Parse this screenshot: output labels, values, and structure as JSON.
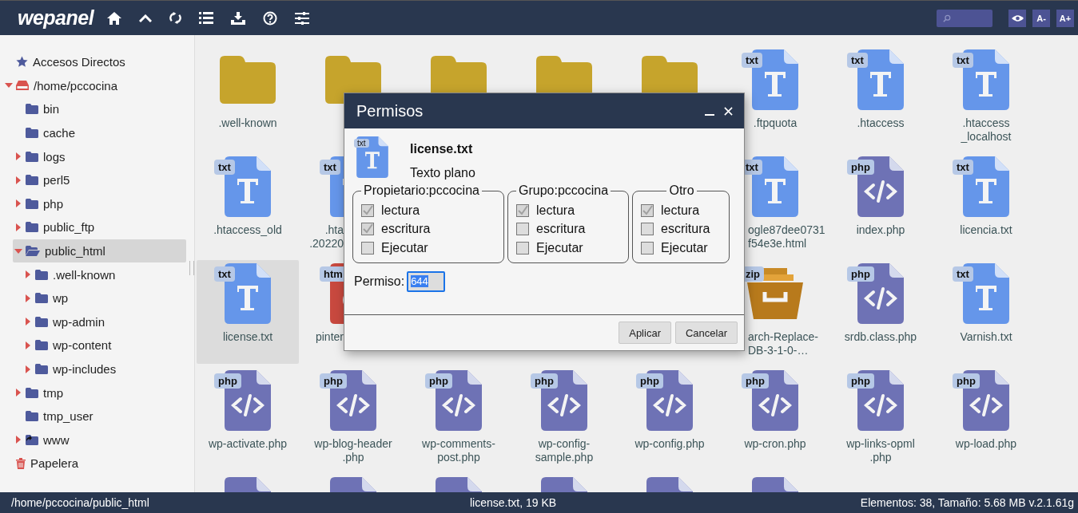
{
  "app": {
    "logo": "wepanel",
    "font_buttons": [
      "A-",
      "A+"
    ]
  },
  "sidebar": {
    "items": [
      {
        "label": "Accesos Directos",
        "kind": "star",
        "selected": false
      },
      {
        "label": "/home/pccocina",
        "kind": "drive",
        "expandable": true,
        "expanded": true,
        "selected": false,
        "children": [
          {
            "label": "bin",
            "kind": "folder",
            "selected": false
          },
          {
            "label": "cache",
            "kind": "folder",
            "selected": false
          },
          {
            "label": "logs",
            "kind": "folder",
            "expandable": true,
            "expanded": false,
            "selected": false
          },
          {
            "label": "perl5",
            "kind": "folder",
            "expandable": true,
            "expanded": false,
            "selected": false
          },
          {
            "label": "php",
            "kind": "folder",
            "expandable": true,
            "expanded": false,
            "selected": false
          },
          {
            "label": "public_ftp",
            "kind": "folder",
            "expandable": true,
            "expanded": false,
            "selected": false
          },
          {
            "label": "public_html",
            "kind": "open-folder",
            "expandable": true,
            "expanded": true,
            "selected": true,
            "children": [
              {
                "label": ".well-known",
                "kind": "folder",
                "expandable": true,
                "expanded": false,
                "selected": false
              },
              {
                "label": "wp",
                "kind": "folder",
                "expandable": true,
                "expanded": false,
                "selected": false
              },
              {
                "label": "wp-admin",
                "kind": "folder",
                "expandable": true,
                "expanded": false,
                "selected": false
              },
              {
                "label": "wp-content",
                "kind": "folder",
                "expandable": true,
                "expanded": false,
                "selected": false
              },
              {
                "label": "wp-includes",
                "kind": "folder",
                "expandable": true,
                "expanded": false,
                "selected": false
              }
            ]
          },
          {
            "label": "tmp",
            "kind": "folder",
            "expandable": true,
            "expanded": false,
            "selected": false
          },
          {
            "label": "tmp_user",
            "kind": "folder",
            "selected": false
          },
          {
            "label": "www",
            "kind": "link-folder",
            "expandable": true,
            "expanded": false,
            "selected": false
          }
        ]
      },
      {
        "label": "Papelera",
        "kind": "trash",
        "selected": false
      }
    ]
  },
  "files": [
    {
      "kind": "folder",
      "label": [
        ".well-known"
      ],
      "selected": false
    },
    {
      "kind": "folder",
      "selected": false
    },
    {
      "kind": "folder",
      "selected": false
    },
    {
      "kind": "folder",
      "selected": false
    },
    {
      "kind": "folder",
      "selected": false
    },
    {
      "kind": "txt",
      "badge": "txt",
      "label": [
        ".ftpquota"
      ],
      "selected": false
    },
    {
      "kind": "txt",
      "badge": "txt",
      "label": [
        ".htaccess"
      ],
      "selected": false
    },
    {
      "kind": "txt",
      "badge": "txt",
      "label": [
        ".htaccess",
        "_localhost"
      ],
      "selected": false
    },
    {
      "kind": "txt",
      "badge": "txt",
      "label": [
        ".htaccess_old"
      ],
      "selected": false
    },
    {
      "kind": "txt",
      "badge": "txt",
      "label": [
        ".hta",
        ".20220"
      ],
      "clipped_right": true,
      "selected": false
    },
    {
      "kind": "covered"
    },
    {
      "kind": "covered"
    },
    {
      "kind": "covered"
    },
    {
      "kind": "txt",
      "badge": "txt",
      "label": [
        "ogle87dee0731",
        "f54e3e.html"
      ],
      "clipped_left": true,
      "selected": false
    },
    {
      "kind": "php",
      "badge": "php",
      "label": [
        "index.php"
      ],
      "selected": false
    },
    {
      "kind": "txt",
      "badge": "txt",
      "label": [
        "licencia.txt"
      ],
      "selected": false
    },
    {
      "kind": "txt",
      "badge": "txt",
      "label": [
        "license.txt"
      ],
      "selected": true
    },
    {
      "kind": "htm",
      "badge": "htm",
      "label": [
        "pinter"
      ],
      "clipped_right": true,
      "selected": false
    },
    {
      "kind": "covered"
    },
    {
      "kind": "covered"
    },
    {
      "kind": "covered"
    },
    {
      "kind": "zip",
      "badge": "zip",
      "label": [
        "arch-Replace-",
        "DB-3-1-0-…"
      ],
      "clipped_left": true,
      "selected": false
    },
    {
      "kind": "php",
      "badge": "php",
      "label": [
        "srdb.class.php"
      ],
      "selected": false
    },
    {
      "kind": "txt",
      "badge": "txt",
      "label": [
        "Varnish.txt"
      ],
      "selected": false
    },
    {
      "kind": "php",
      "badge": "php",
      "label": [
        "wp-activate.php"
      ],
      "selected": false
    },
    {
      "kind": "php",
      "badge": "php",
      "label": [
        "wp-blog-header",
        ".php"
      ],
      "selected": false
    },
    {
      "kind": "php",
      "badge": "php",
      "label": [
        "wp-comments-",
        "post.php"
      ],
      "selected": false
    },
    {
      "kind": "php",
      "badge": "php",
      "label": [
        "wp-config-",
        "sample.php"
      ],
      "selected": false
    },
    {
      "kind": "php",
      "badge": "php",
      "label": [
        "wp-config.php"
      ],
      "selected": false
    },
    {
      "kind": "php",
      "badge": "php",
      "label": [
        "wp-cron.php"
      ],
      "selected": false
    },
    {
      "kind": "php",
      "badge": "php",
      "label": [
        "wp-links-opml",
        ".php"
      ],
      "selected": false
    },
    {
      "kind": "php",
      "badge": "php",
      "label": [
        "wp-load.php"
      ],
      "selected": false
    },
    {
      "kind": "php",
      "selected": false
    },
    {
      "kind": "php",
      "selected": false
    },
    {
      "kind": "php",
      "selected": false
    },
    {
      "kind": "php",
      "selected": false
    },
    {
      "kind": "php",
      "selected": false
    },
    {
      "kind": "php",
      "selected": false
    }
  ],
  "dialog": {
    "title": "Permisos",
    "file": {
      "badge": "txt",
      "name": "license.txt",
      "type": "Texto plano"
    },
    "groups": [
      {
        "legend": "Propietario:pccocina",
        "perms": [
          {
            "label": "lectura",
            "checked": true
          },
          {
            "label": "escritura",
            "checked": true
          },
          {
            "label": "Ejecutar",
            "checked": false
          }
        ]
      },
      {
        "legend": "Grupo:pccocina",
        "perms": [
          {
            "label": "lectura",
            "checked": true
          },
          {
            "label": "escritura",
            "checked": false
          },
          {
            "label": "Ejecutar",
            "checked": false
          }
        ]
      },
      {
        "legend": "Otro",
        "perms": [
          {
            "label": "lectura",
            "checked": true
          },
          {
            "label": "escritura",
            "checked": false
          },
          {
            "label": "Ejecutar",
            "checked": false
          }
        ]
      }
    ],
    "permission": {
      "label": "Permiso:",
      "value": "644"
    },
    "buttons": [
      "Aplicar",
      "Cancelar"
    ]
  },
  "status_bar": {
    "path": "/home/pccocina/public_html",
    "selection": "license.txt, 19 KB",
    "summary": "Elementos: 38, Tamaño: 5.68 MB v.2.1.61g"
  }
}
